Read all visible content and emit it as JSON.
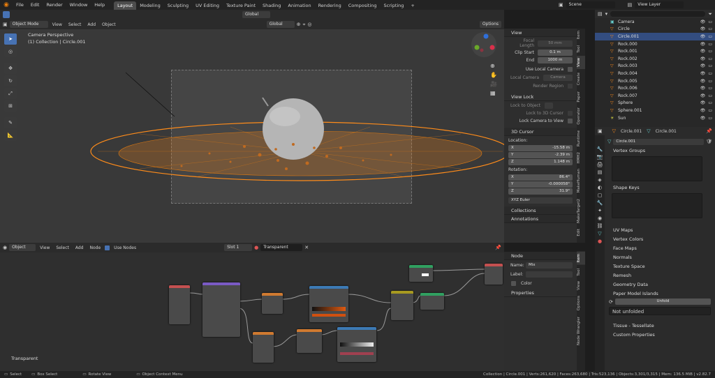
{
  "topbar": {
    "menus": [
      "File",
      "Edit",
      "Render",
      "Window",
      "Help"
    ],
    "workspaces": [
      "Layout",
      "Modeling",
      "Sculpting",
      "UV Editing",
      "Texture Paint",
      "Shading",
      "Animation",
      "Rendering",
      "Compositing",
      "Scripting",
      "+"
    ],
    "scene_label": "Scene",
    "view_layer_label": "View Layer"
  },
  "viewport_header": {
    "mode": "Object Mode",
    "menus": [
      "View",
      "Select",
      "Add",
      "Object"
    ],
    "transform": "Global",
    "options": "Options"
  },
  "viewport": {
    "title": "Camera Perspective",
    "subtitle": "(1) Collection | Circle.001"
  },
  "npanel": {
    "view_title": "View",
    "focal_length_label": "Focal Length",
    "focal_length": "50 mm",
    "clip_start_label": "Clip Start",
    "clip_start": "0.1 m",
    "clip_end_label": "End",
    "clip_end": "1000 m",
    "use_local_camera": "Use Local Camera",
    "local_camera_label": "Local Camera",
    "local_camera_value": "Camera",
    "render_region": "Render Region",
    "view_lock_title": "View Lock",
    "lock_to_object": "Lock to Object",
    "lock_to_3d_cursor": "Lock to 3D Cursor",
    "lock_camera_to_view": "Lock Camera to View",
    "cursor_title": "3D Cursor",
    "location_label": "Location:",
    "loc_x_label": "X",
    "loc_x": "-15.58 m",
    "loc_y_label": "Y",
    "loc_y": "-2.39 m",
    "loc_z_label": "Z",
    "loc_z": "1.148 m",
    "rotation_label": "Rotation:",
    "rot_x_label": "X",
    "rot_x": "86.4°",
    "rot_y_label": "Y",
    "rot_y": "-0.000058°",
    "rot_z_label": "Z",
    "rot_z": "31.9°",
    "rotation_mode": "XYZ Euler",
    "collections": "Collections",
    "annotations": "Annotations",
    "tabs": [
      "Item",
      "Tool",
      "View",
      "Create",
      "Paper",
      "Operator",
      "Runtime",
      "HMH2",
      "MakeHuman",
      "MakeTarget2",
      "Edit"
    ]
  },
  "outliner": {
    "items": [
      {
        "name": "Camera"
      },
      {
        "name": "Circle"
      },
      {
        "name": "Circle.001"
      },
      {
        "name": "Rock.000"
      },
      {
        "name": "Rock.001"
      },
      {
        "name": "Rock.002"
      },
      {
        "name": "Rock.003"
      },
      {
        "name": "Rock.004"
      },
      {
        "name": "Rock.005"
      },
      {
        "name": "Rock.006"
      },
      {
        "name": "Rock.007"
      },
      {
        "name": "Sphere"
      },
      {
        "name": "Sphere.001"
      },
      {
        "name": "Sun"
      }
    ]
  },
  "properties": {
    "object_name": "Circle.001",
    "mesh_name": "Circle.001",
    "data_name": "Circle.001",
    "sections": {
      "vertex_groups": "Vertex Groups",
      "shape_keys": "Shape Keys",
      "uv_maps": "UV Maps",
      "vertex_colors": "Vertex Colors",
      "face_maps": "Face Maps",
      "normals": "Normals",
      "texture_space": "Texture Space",
      "remesh": "Remesh",
      "geometry_data": "Geometry Data",
      "paper_model_islands": "Paper Model Islands",
      "tissue": "Tissue - Tessellate",
      "custom_properties": "Custom Properties"
    },
    "unfold_button": "Unfold",
    "not_unfolded": "Not unfolded"
  },
  "node_header": {
    "editor_type": "Object",
    "menus": [
      "View",
      "Select",
      "Add",
      "Node"
    ],
    "use_nodes": "Use Nodes",
    "slot": "Slot 1",
    "material": "Transparent"
  },
  "node_editor": {
    "material_label": "Transparent"
  },
  "nodepanel": {
    "title": "Node",
    "name_label": "Name:",
    "name_value": "Mix",
    "label_label": "Label:",
    "color_label": "Color",
    "properties_label": "Properties",
    "tabs": [
      "Item",
      "Tool",
      "View",
      "Options",
      "Node Wrangler"
    ]
  },
  "status": {
    "select": "Select",
    "box_select": "Box Select",
    "rotate_view": "Rotate View",
    "context_menu": "Object Context Menu",
    "stats": "Collection | Circle.001 | Verts:261,620 | Faces:263,680 | Tris:523,136 | Objects:3,301/3,315 | Mem: 136.5 MiB | v2.82.7"
  },
  "colors": {
    "accent": "#4772b3",
    "selection": "#ff8c1a",
    "selected_row": "#334d80"
  }
}
